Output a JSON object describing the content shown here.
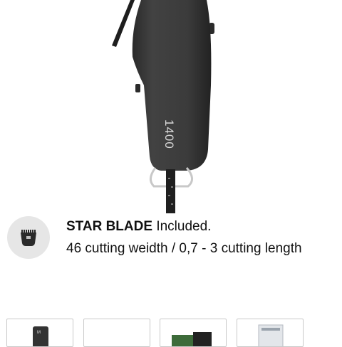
{
  "product": {
    "model_label": "1400"
  },
  "feature": {
    "icon": "clipper-blade-icon",
    "title_bold": "STAR BLADE",
    "title_rest": " Included.",
    "description": "46 cutting weidth / 0,7 - 3 cutting length"
  },
  "thumbnails": [
    {
      "name": "thumbnail-1",
      "icon": "clipper-thumbnail"
    },
    {
      "name": "thumbnail-2",
      "icon": "blank-thumbnail"
    },
    {
      "name": "thumbnail-3",
      "icon": "box-thumbnail"
    },
    {
      "name": "thumbnail-4",
      "icon": "comb-thumbnail"
    }
  ],
  "colors": {
    "clipper_body": "#3a3a3a",
    "icon_circle": "#e6e6e6",
    "text": "#111111"
  }
}
